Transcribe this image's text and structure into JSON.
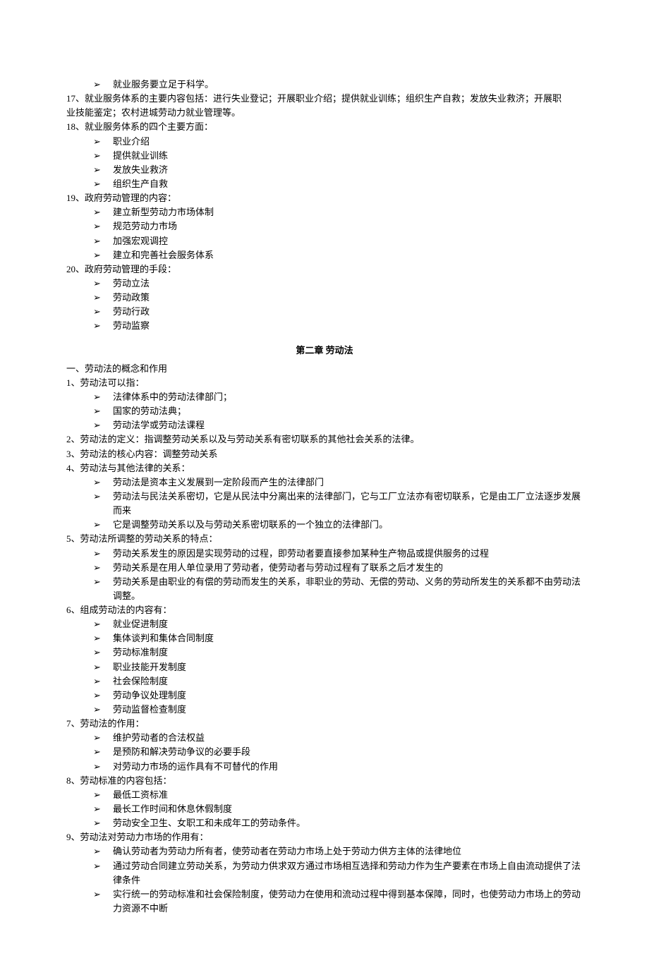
{
  "topBullet": "就业服务要立足于科学。",
  "para17a": "17、就业服务体系的主要内容包括：进行失业登记；开展职业介绍；提供就业训练；组织生产自救；发放失业救济；开展职",
  "para17b": "业技能鉴定；农村进城劳动力就业管理等。",
  "para18": "18、就业服务体系的四个主要方面：",
  "list18": [
    "职业介绍",
    "提供就业训练",
    "发放失业救济",
    "组织生产自救"
  ],
  "para19": "19、政府劳动管理的内容：",
  "list19": [
    "建立新型劳动力市场体制",
    "规范劳动力市场",
    "加强宏观调控",
    "建立和完善社会服务体系"
  ],
  "para20": "20、政府劳动管理的手段：",
  "list20": [
    "劳动立法",
    "劳动政策",
    "劳动行政",
    "劳动监察"
  ],
  "chapterTitle": "第二章 劳动法",
  "sectionA": "一、劳动法的概念和作用",
  "q1": "1、劳动法可以指：",
  "list1": [
    "法律体系中的劳动法律部门；",
    "国家的劳动法典；",
    "劳动法学或劳动法课程"
  ],
  "q2": "2、劳动法的定义：指调整劳动关系以及与劳动关系有密切联系的其他社会关系的法律。",
  "q3": "3、劳动法的核心内容：调整劳动关系",
  "q4": "4、劳动法与其他法律的关系：",
  "list4": [
    "劳动法是资本主义发展到一定阶段而产生的法律部门",
    "劳动法与民法关系密切，它是从民法中分离出来的法律部门，它与工厂立法亦有密切联系，它是由工厂立法逐步发展而来",
    "它是调整劳动关系以及与劳动关系密切联系的一个独立的法律部门。"
  ],
  "q5": "5、劳动法所调整的劳动关系的特点：",
  "list5": [
    "劳动关系发生的原因是实现劳动的过程，即劳动者要直接参加某种生产物品或提供服务的过程",
    "劳动关系是在用人单位录用了劳动者，使劳动者与劳动过程有了联系之后才发生的",
    "劳动关系是由职业的有偿的劳动而发生的关系，非职业的劳动、无偿的劳动、义务的劳动所发生的关系都不由劳动法调整。"
  ],
  "q6": "6、组成劳动法的内容有：",
  "list6": [
    "就业促进制度",
    "集体谈判和集体合同制度",
    "劳动标准制度",
    "职业技能开发制度",
    "社会保险制度",
    "劳动争议处理制度",
    "劳动监督检查制度"
  ],
  "q7": "7、劳动法的作用：",
  "list7": [
    "维护劳动者的合法权益",
    "是预防和解决劳动争议的必要手段",
    "对劳动力市场的运作具有不可替代的作用"
  ],
  "q8": "8、劳动标准的内容包括：",
  "list8": [
    "最低工资标准",
    "最长工作时间和休息休假制度",
    "劳动安全卫生、女职工和未成年工的劳动条件。"
  ],
  "q9": "9、劳动法对劳动力市场的作用有：",
  "list9": [
    "确认劳动者为劳动力所有者，使劳动者在劳动力市场上处于劳动力供方主体的法律地位",
    "通过劳动合同建立劳动关系，为劳动力供求双方通过市场相互选择和劳动力作为生产要素在市场上自由流动提供了法律条件",
    "实行统一的劳动标准和社会保险制度，使劳动力在使用和流动过程中得到基本保障，同时，也使劳动力市场上的劳动力资源不中断"
  ],
  "arrowGlyph": "➢"
}
